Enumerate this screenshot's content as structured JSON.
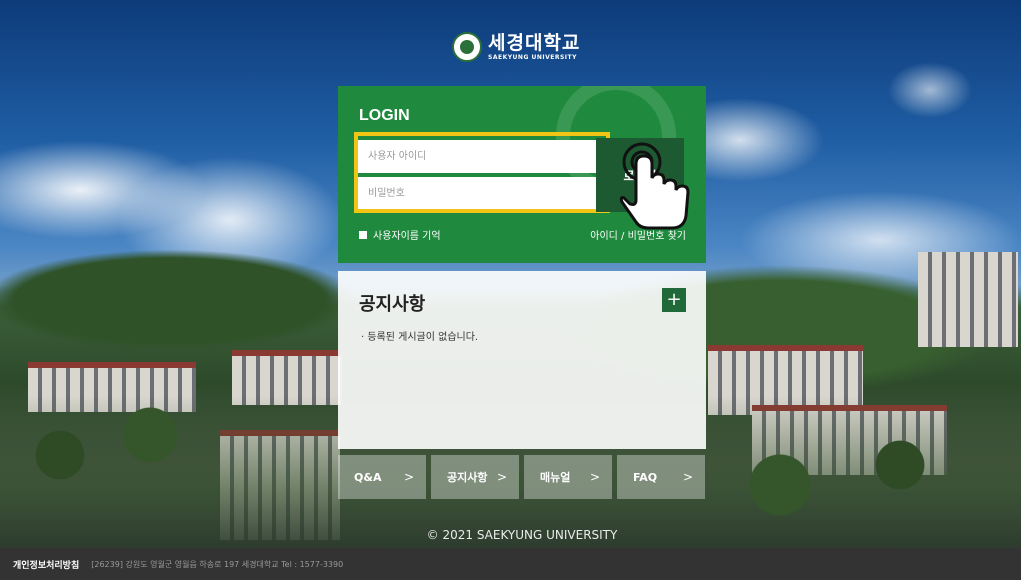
{
  "logo": {
    "name": "세경대학교",
    "subtitle": "SAEKYUNG UNIVERSITY"
  },
  "login": {
    "title": "LOGIN",
    "id_placeholder": "사용자 아이디",
    "pw_placeholder": "비밀번호",
    "button_label": "로그인",
    "remember_label": "사용자이름 기억",
    "find_link": "아이디 / 비밀번호 찾기"
  },
  "notice": {
    "title": "공지사항",
    "add_label": "+",
    "empty_text": "· 등록된 게시글이 없습니다."
  },
  "quick_links": [
    {
      "label": "Q&A",
      "chevron": ">"
    },
    {
      "label": "공지사항",
      "chevron": ">"
    },
    {
      "label": "매뉴얼",
      "chevron": ">"
    },
    {
      "label": "FAQ",
      "chevron": ">"
    }
  ],
  "copyright": "© 2021 SAEKYUNG UNIVERSITY",
  "footer": {
    "privacy_label": "개인정보처리방침",
    "info": "[26239] 강원도 영월군 영월읍 하송로 197 세경대학교   Tel : 1577-3390"
  },
  "colors": {
    "login_bg": "#1f8a3e",
    "login_button_bg": "#1d5a31",
    "highlight": "#f2c514",
    "footer_bg": "#333333"
  },
  "icons": {
    "pointer": "hand-pointer-icon",
    "emblem": "university-emblem-icon"
  }
}
